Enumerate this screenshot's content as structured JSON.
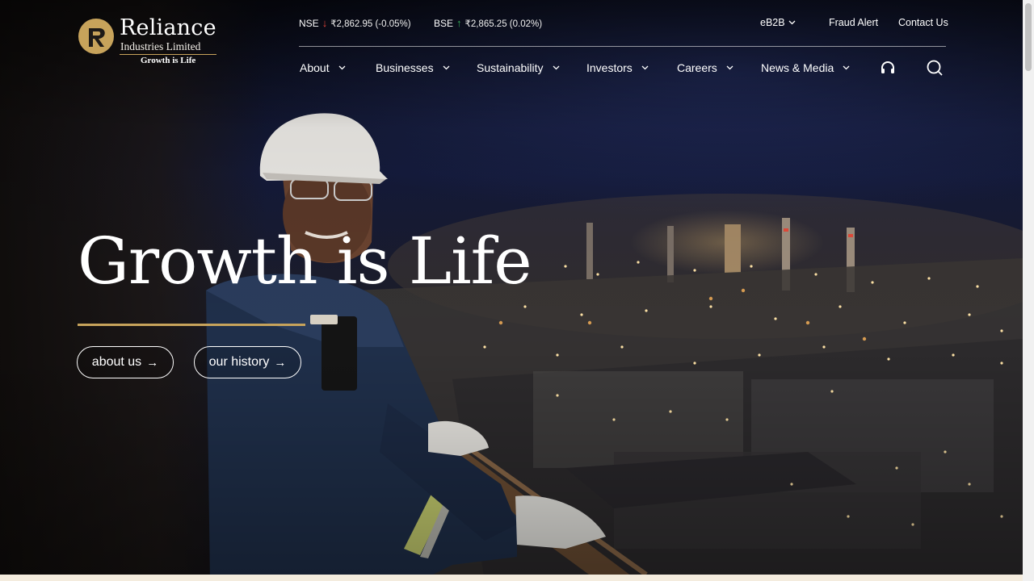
{
  "brand": {
    "name": "Reliance",
    "subtitle": "Industries Limited",
    "tagline": "Growth is Life",
    "gold": "#c7a35b"
  },
  "topbar": {
    "nse": {
      "label": "NSE",
      "direction": "down",
      "value": "₹2,862.95 (-0.05%)"
    },
    "bse": {
      "label": "BSE",
      "direction": "up",
      "value": "₹2,865.25 (0.02%)"
    },
    "eb2b": "eB2B",
    "fraud_alert": "Fraud Alert",
    "contact_us": "Contact Us"
  },
  "nav": {
    "items": [
      {
        "label": "About"
      },
      {
        "label": "Businesses"
      },
      {
        "label": "Sustainability"
      },
      {
        "label": "Investors"
      },
      {
        "label": "Careers"
      },
      {
        "label": "News & Media"
      }
    ],
    "icons": [
      "headphones-icon",
      "search-icon"
    ]
  },
  "hero": {
    "title": "Growth is Life",
    "buttons": [
      {
        "label": "about us",
        "icon": "arrow-right-icon"
      },
      {
        "label": "our history",
        "icon": "arrow-right-icon"
      }
    ]
  }
}
